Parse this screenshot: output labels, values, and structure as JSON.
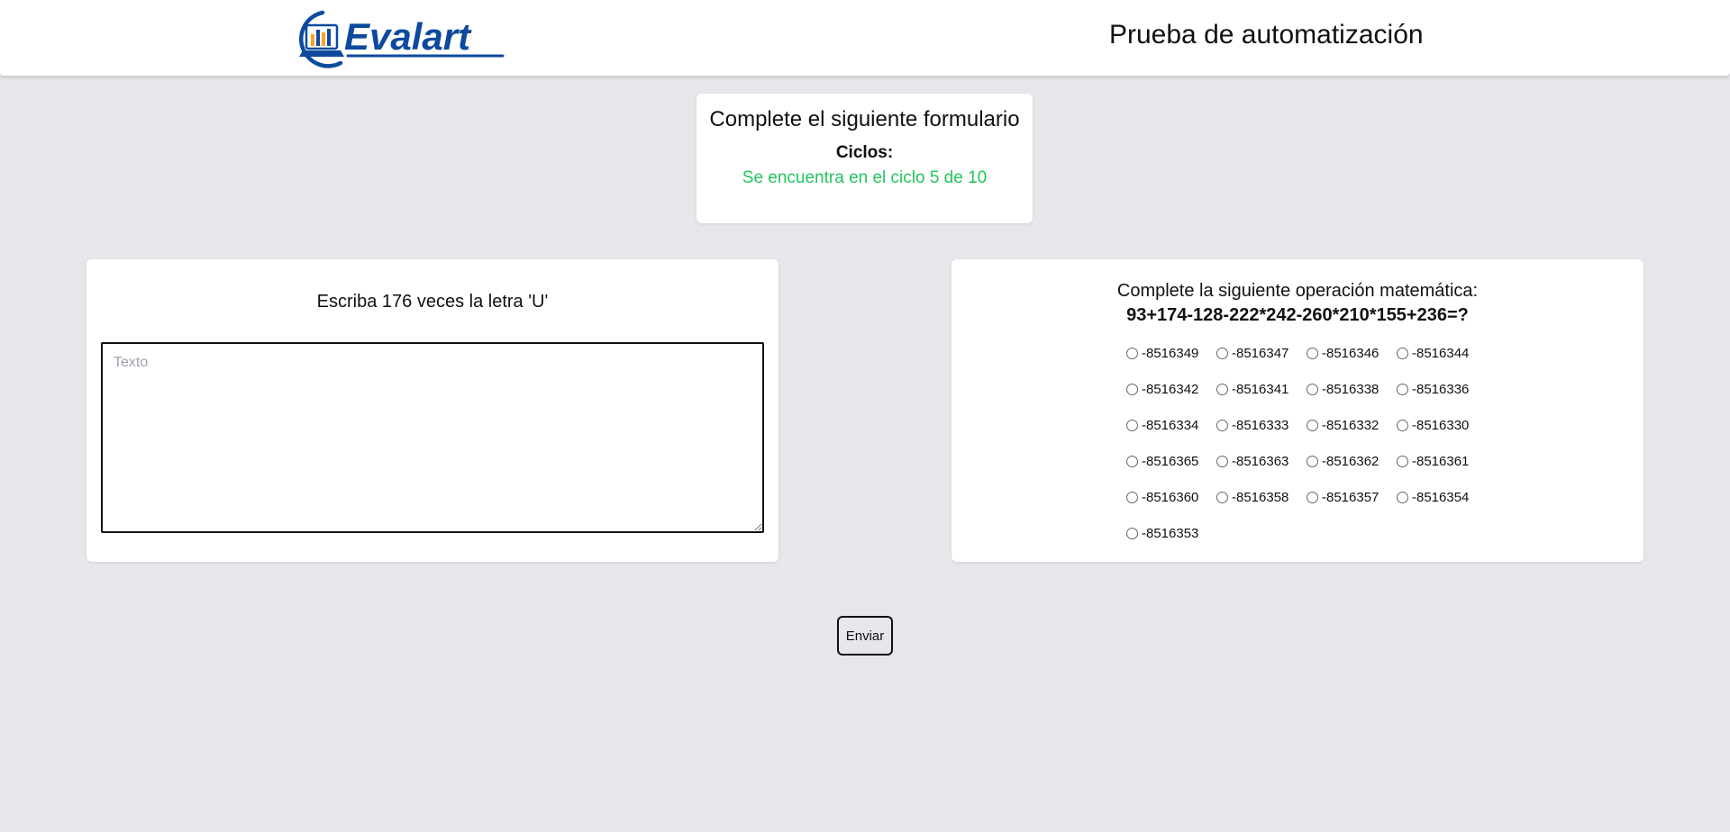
{
  "header": {
    "logo_text": "Evalart",
    "title": "Prueba de automatización"
  },
  "cycle": {
    "title": "Complete el siguiente formulario",
    "label": "Ciclos:",
    "status": "Se encuentra en el ciclo 5 de 10"
  },
  "text_task": {
    "instruction": "Escriba 176 veces la letra 'U'",
    "placeholder": "Texto",
    "value": ""
  },
  "math_task": {
    "instruction": "Complete la siguiente operación matemática:",
    "expression": "93+174-128-222*242-260*210*155+236=?",
    "options": [
      "-8516349",
      "-8516347",
      "-8516346",
      "-8516344",
      "-8516342",
      "-8516341",
      "-8516338",
      "-8516336",
      "-8516334",
      "-8516333",
      "-8516332",
      "-8516330",
      "-8516365",
      "-8516363",
      "-8516362",
      "-8516361",
      "-8516360",
      "-8516358",
      "-8516357",
      "-8516354",
      "-8516353"
    ]
  },
  "submit": {
    "label": "Enviar"
  },
  "colors": {
    "background": "#e5e7eb",
    "card": "#ffffff",
    "status_green": "#22c55e",
    "logo_blue": "#0d4a9e",
    "logo_orange": "#f5a623"
  }
}
